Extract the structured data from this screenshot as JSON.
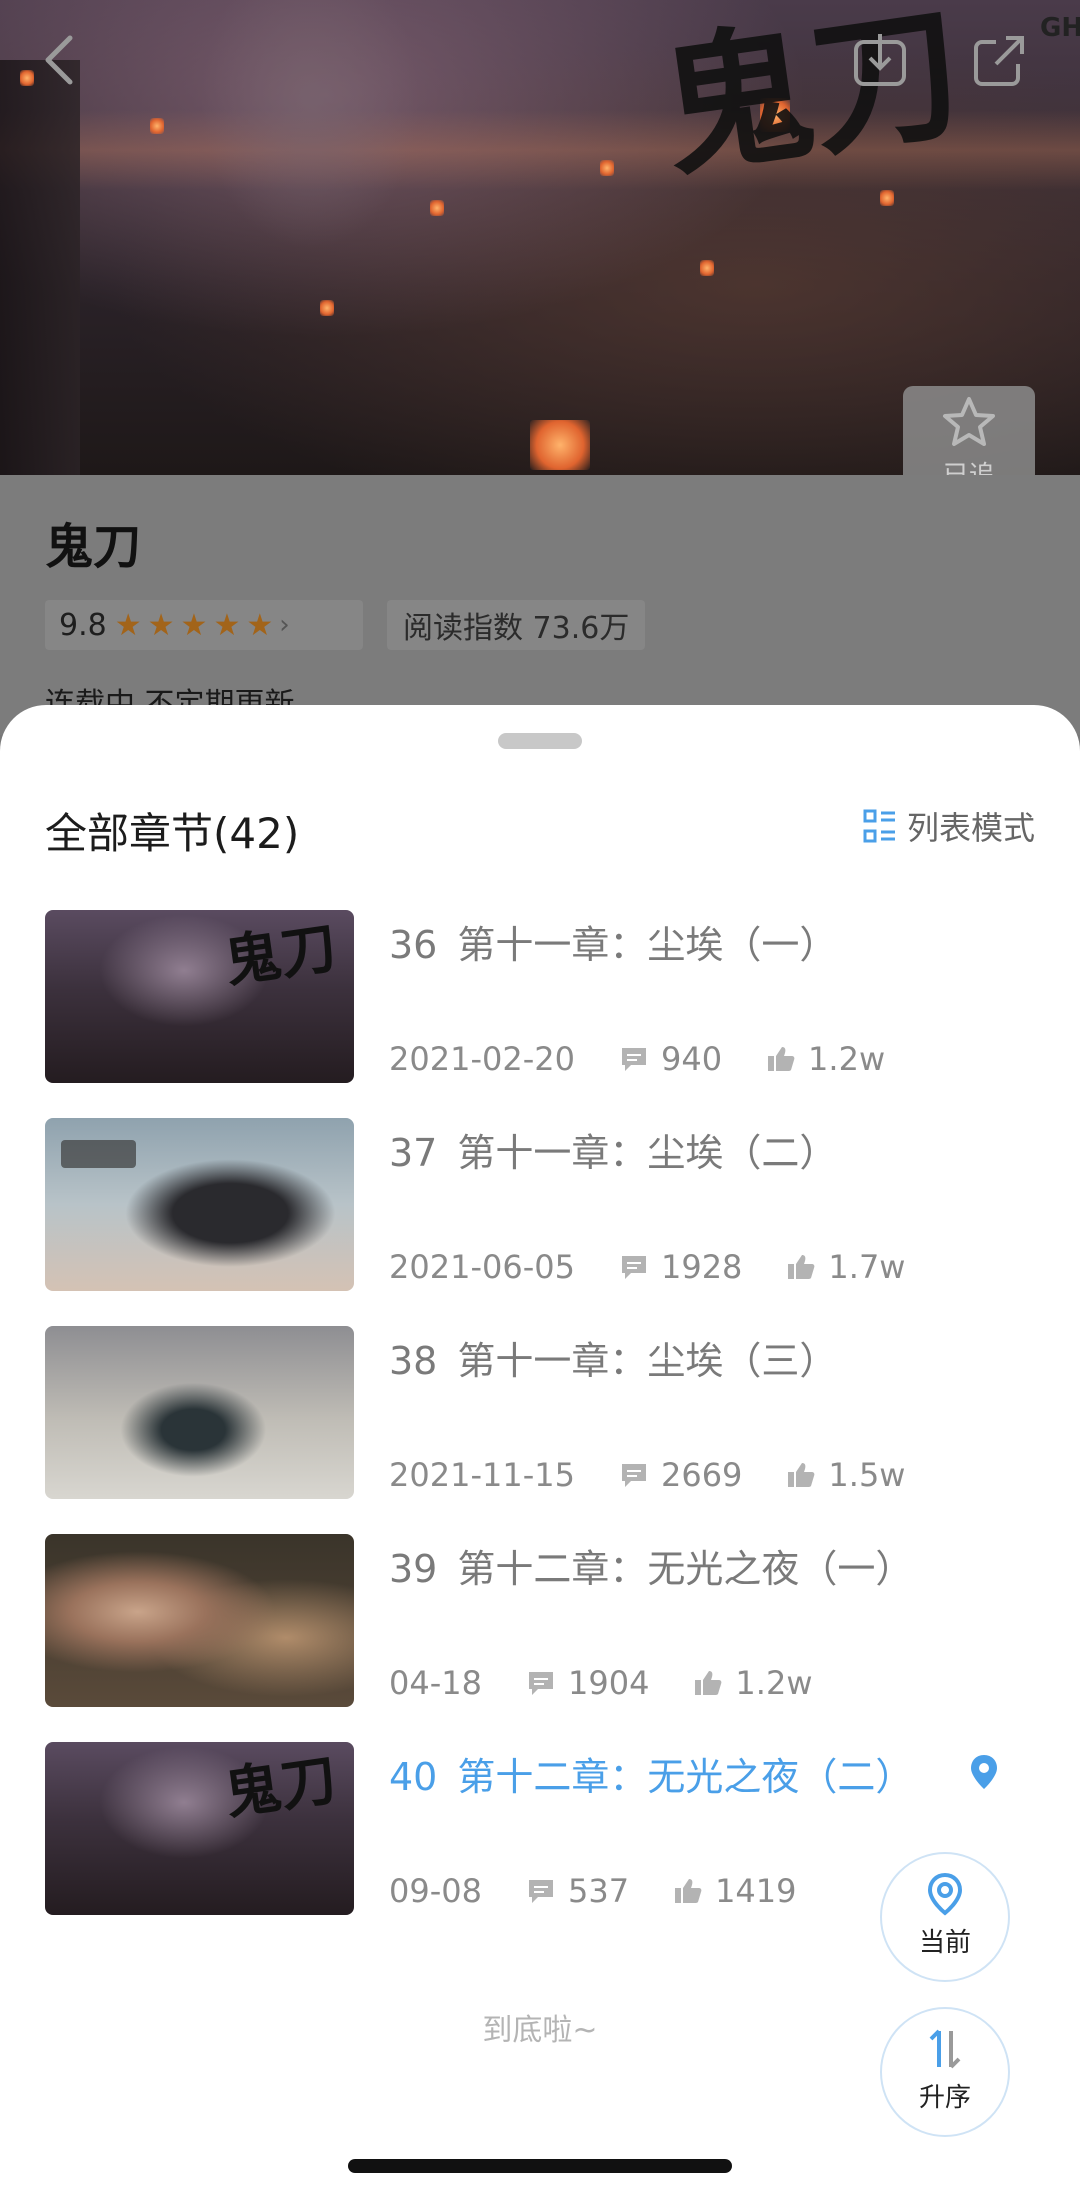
{
  "hero": {
    "title_art": "鬼刀",
    "vertical_text": "GHOSTBLADE",
    "follow_label": "已追"
  },
  "book": {
    "title": "鬼刀",
    "rating": "9.8",
    "stars": 5,
    "read_index_label": "阅读指数 73.6万",
    "status": "连载中 不定期更新"
  },
  "sheet": {
    "title": "全部章节(42)",
    "view_mode_label": "列表模式",
    "bottom_text": "到底啦~",
    "current_button": "当前",
    "sort_button": "升序"
  },
  "chapters": [
    {
      "num": "36",
      "title": "第十一章：尘埃（一）",
      "date": "2021-02-20",
      "comments": "940",
      "likes": "1.2w"
    },
    {
      "num": "37",
      "title": "第十一章：尘埃（二）",
      "date": "2021-06-05",
      "comments": "1928",
      "likes": "1.7w"
    },
    {
      "num": "38",
      "title": "第十一章：尘埃（三）",
      "date": "2021-11-15",
      "comments": "2669",
      "likes": "1.5w"
    },
    {
      "num": "39",
      "title": "第十二章：无光之夜（一）",
      "date": "04-18",
      "comments": "1904",
      "likes": "1.2w"
    },
    {
      "num": "40",
      "title": "第十二章：无光之夜（二）",
      "date": "09-08",
      "comments": "537",
      "likes": "1419",
      "current": true
    }
  ],
  "colors": {
    "accent": "#4a9fe8",
    "star": "#a2641a"
  }
}
